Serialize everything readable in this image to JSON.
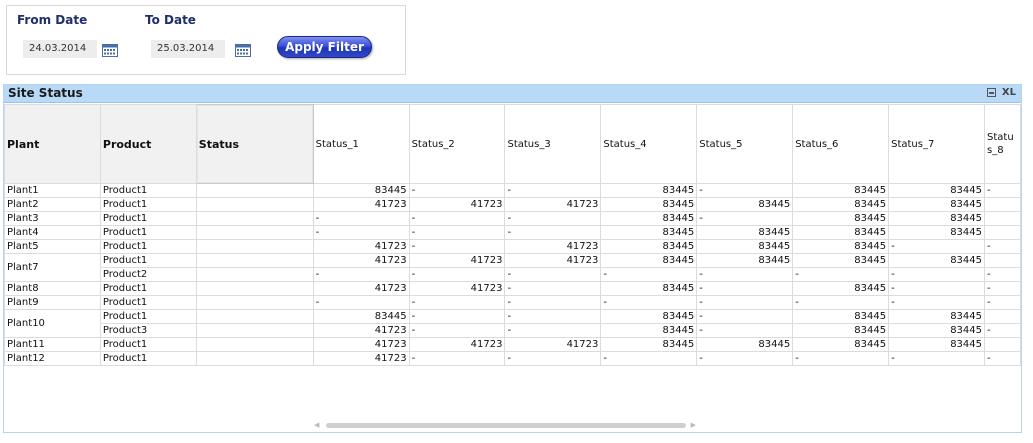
{
  "filters": {
    "from_label": "From Date",
    "from_value": "24.03.2014",
    "to_label": "To Date",
    "to_value": "25.03.2014",
    "apply_label": "Apply Filter"
  },
  "table": {
    "caption": "Site Status",
    "caption_icons": {
      "print": "print-icon",
      "xl": "XL"
    },
    "headers": [
      "Plant",
      "Product",
      "Status",
      "Status_1",
      "Status_2",
      "Status_3",
      "Status_4",
      "Status_5",
      "Status_6",
      "Status_7",
      "Status_8"
    ],
    "rows": [
      {
        "plant": "Plant1",
        "product": "Product1",
        "values": [
          "83445",
          "-",
          "-",
          "83445",
          "-",
          "83445",
          "83445",
          "-"
        ]
      },
      {
        "plant": "Plant2",
        "product": "Product1",
        "values": [
          "41723",
          "41723",
          "41723",
          "83445",
          "83445",
          "83445",
          "83445",
          ""
        ]
      },
      {
        "plant": "Plant3",
        "product": "Product1",
        "values": [
          "-",
          "-",
          "-",
          "83445",
          "-",
          "83445",
          "83445",
          ""
        ]
      },
      {
        "plant": "Plant4",
        "product": "Product1",
        "values": [
          "-",
          "-",
          "-",
          "83445",
          "83445",
          "83445",
          "83445",
          ""
        ]
      },
      {
        "plant": "Plant5",
        "product": "Product1",
        "values": [
          "41723",
          "-",
          "41723",
          "83445",
          "83445",
          "83445",
          "-",
          "-"
        ]
      },
      {
        "plant": "Plant7",
        "product": "Product1",
        "values": [
          "41723",
          "41723",
          "41723",
          "83445",
          "83445",
          "83445",
          "83445",
          ""
        ]
      },
      {
        "plant": "",
        "product": "Product2",
        "values": [
          "-",
          "-",
          "-",
          "-",
          "-",
          "-",
          "-",
          "-"
        ]
      },
      {
        "plant": "Plant8",
        "product": "Product1",
        "values": [
          "41723",
          "41723",
          "-",
          "83445",
          "-",
          "83445",
          "-",
          "-"
        ]
      },
      {
        "plant": "Plant9",
        "product": "Product1",
        "values": [
          "-",
          "-",
          "-",
          "-",
          "-",
          "-",
          "-",
          "-"
        ]
      },
      {
        "plant": "Plant10",
        "product": "Product1",
        "values": [
          "83445",
          "-",
          "-",
          "83445",
          "-",
          "83445",
          "83445",
          ""
        ]
      },
      {
        "plant": "",
        "product": "Product3",
        "values": [
          "41723",
          "-",
          "-",
          "83445",
          "-",
          "83445",
          "83445",
          "-"
        ]
      },
      {
        "plant": "Plant11",
        "product": "Product1",
        "values": [
          "41723",
          "41723",
          "41723",
          "83445",
          "83445",
          "83445",
          "83445",
          ""
        ]
      },
      {
        "plant": "Plant12",
        "product": "Product1",
        "values": [
          "41723",
          "-",
          "-",
          "-",
          "-",
          "-",
          "-",
          "-"
        ]
      }
    ]
  }
}
